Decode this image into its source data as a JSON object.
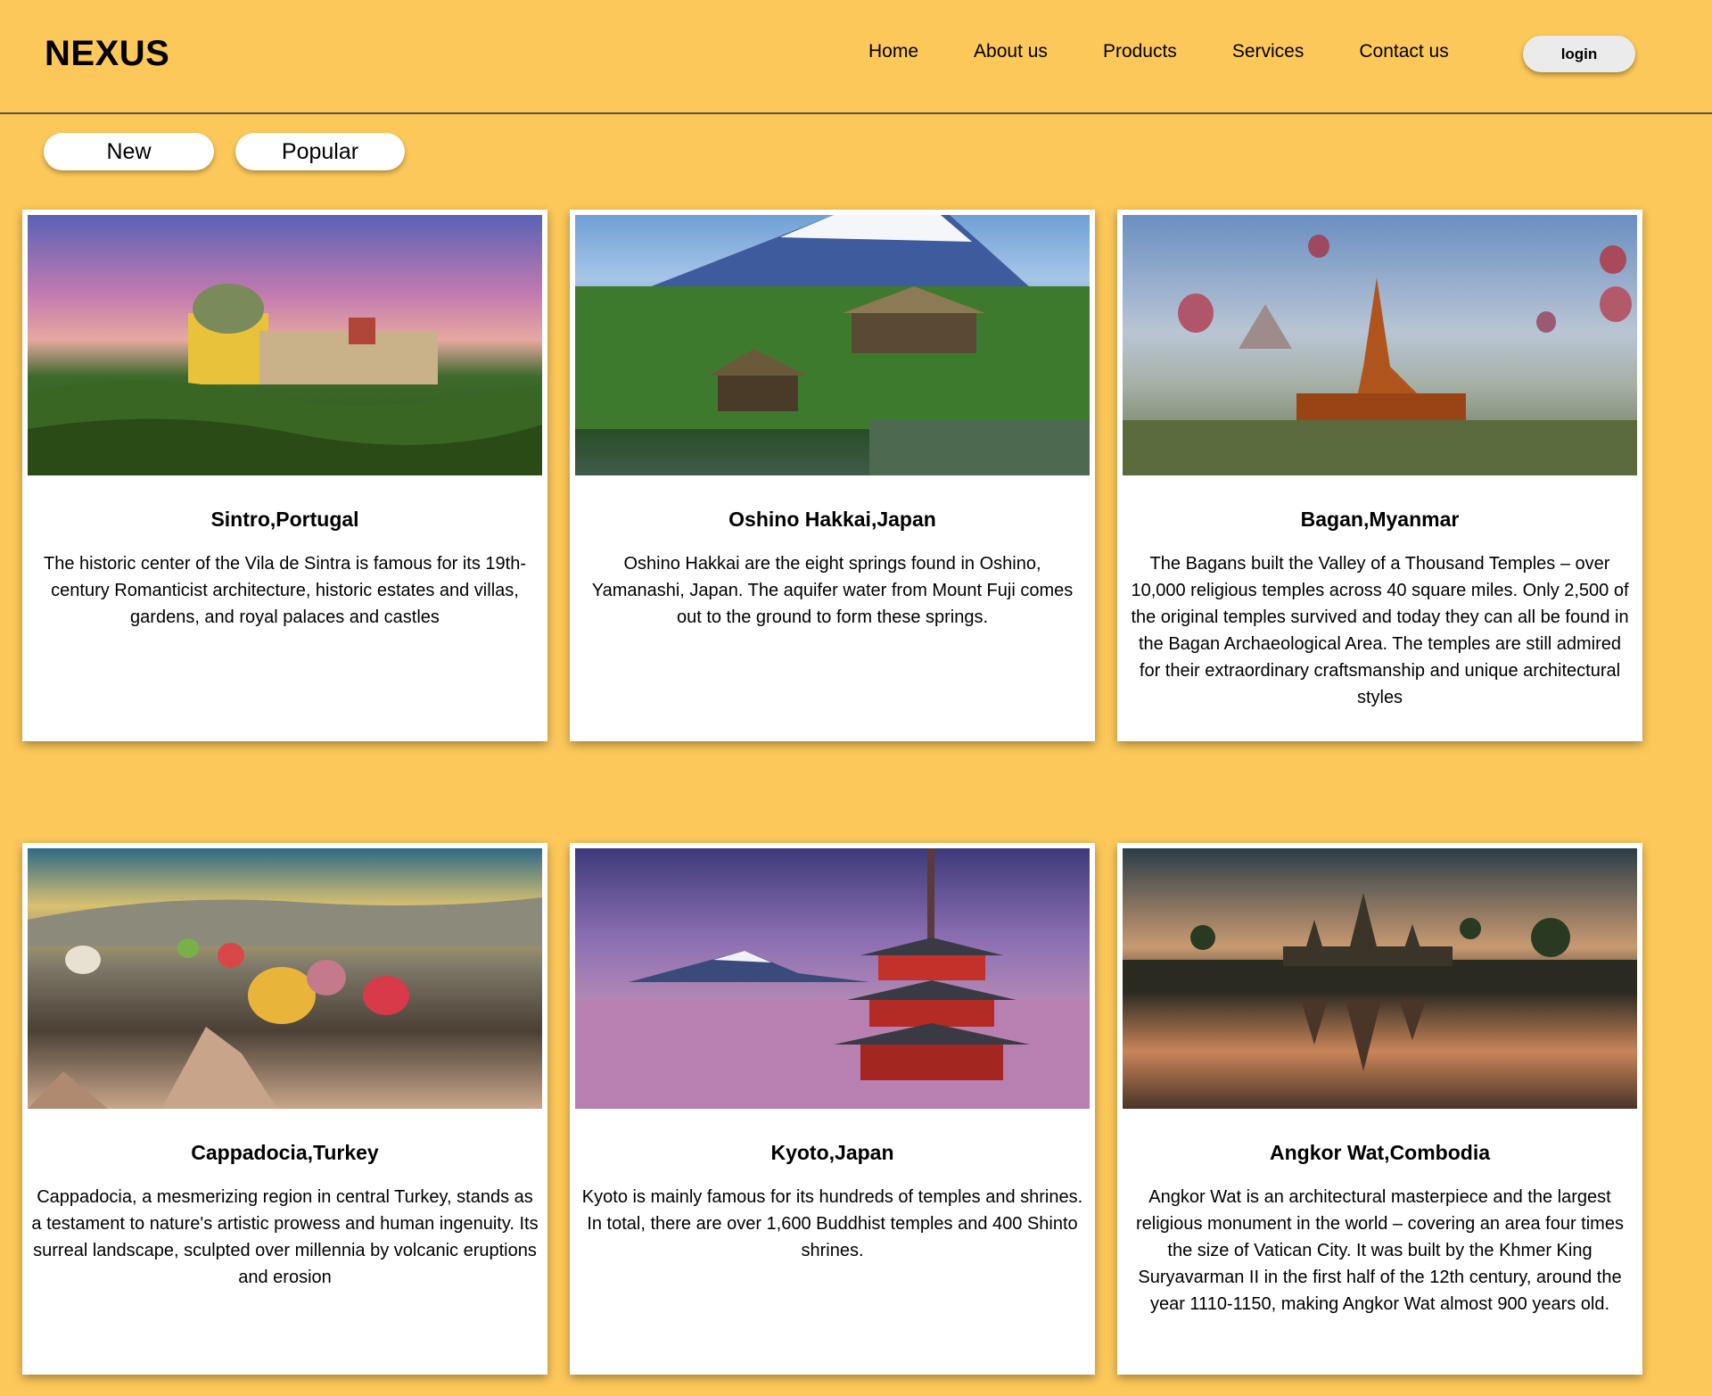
{
  "header": {
    "logo": "NEXUS",
    "nav": [
      "Home",
      "About us",
      "Products",
      "Services",
      "Contact us"
    ],
    "login_label": "login"
  },
  "filters": {
    "new_label": "New",
    "popular_label": "Popular"
  },
  "cards": [
    {
      "title": "Sintro,Portugal",
      "text": "The historic center of the Vila de Sintra is famous for its 19th-century Romanticist architecture, historic estates and villas, gardens, and royal palaces and castles"
    },
    {
      "title": "Oshino Hakkai,Japan",
      "text": "Oshino Hakkai are the eight springs found in Oshino, Yamanashi, Japan. The aquifer water from Mount Fuji comes out to the ground to form these springs."
    },
    {
      "title": "Bagan,Myanmar",
      "text": "The Bagans built the Valley of a Thousand Temples – over 10,000 religious temples across 40 square miles. Only 2,500 of the original temples survived and today they can all be found in the Bagan Archaeological Area. The temples are still admired for their extraordinary craftsmanship and unique architectural styles"
    },
    {
      "title": "Cappadocia,Turkey",
      "text": "Cappadocia, a mesmerizing region in central Turkey, stands as a testament to nature's artistic prowess and human ingenuity. Its surreal landscape, sculpted over millennia by volcanic eruptions and erosion"
    },
    {
      "title": "Kyoto,Japan",
      "text": "Kyoto is mainly famous for its hundreds of temples and shrines. In total, there are over 1,600 Buddhist temples and 400 Shinto shrines."
    },
    {
      "title": "Angkor Wat,Combodia",
      "text": "Angkor Wat is an architectural masterpiece and the largest religious monument in the world – covering an area four times the size of Vatican City. It was built by the Khmer King Suryavarman II in the first half of the 12th century, around the year 1110-1150, making Angkor Wat almost 900 years old."
    }
  ],
  "colors": {
    "page_background": "#fdc85a",
    "card_background": "#ffffff",
    "button_background": "#ffffff",
    "login_background": "#ebebeb"
  }
}
